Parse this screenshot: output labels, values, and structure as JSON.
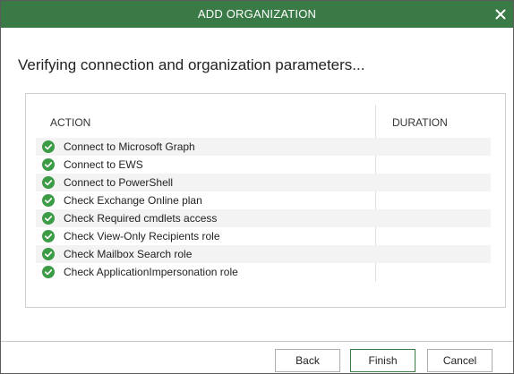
{
  "dialog": {
    "title": "ADD ORGANIZATION",
    "close_icon": "close-icon"
  },
  "heading": "Verifying connection and organization parameters...",
  "table": {
    "columns": [
      "ACTION",
      "DURATION"
    ],
    "rows": [
      {
        "status": "success",
        "action": "Connect to Microsoft Graph",
        "duration": ""
      },
      {
        "status": "success",
        "action": "Connect to EWS",
        "duration": ""
      },
      {
        "status": "success",
        "action": "Connect to PowerShell",
        "duration": ""
      },
      {
        "status": "success",
        "action": "Check Exchange Online plan",
        "duration": ""
      },
      {
        "status": "success",
        "action": "Check Required cmdlets access",
        "duration": ""
      },
      {
        "status": "success",
        "action": "Check View-Only Recipients role",
        "duration": ""
      },
      {
        "status": "success",
        "action": "Check Mailbox Search role",
        "duration": ""
      },
      {
        "status": "success",
        "action": "Check ApplicationImpersonation role",
        "duration": ""
      }
    ]
  },
  "buttons": {
    "back": "Back",
    "finish": "Finish",
    "cancel": "Cancel"
  },
  "colors": {
    "titlebar": "#3a7a46",
    "success": "#3c9b45"
  }
}
